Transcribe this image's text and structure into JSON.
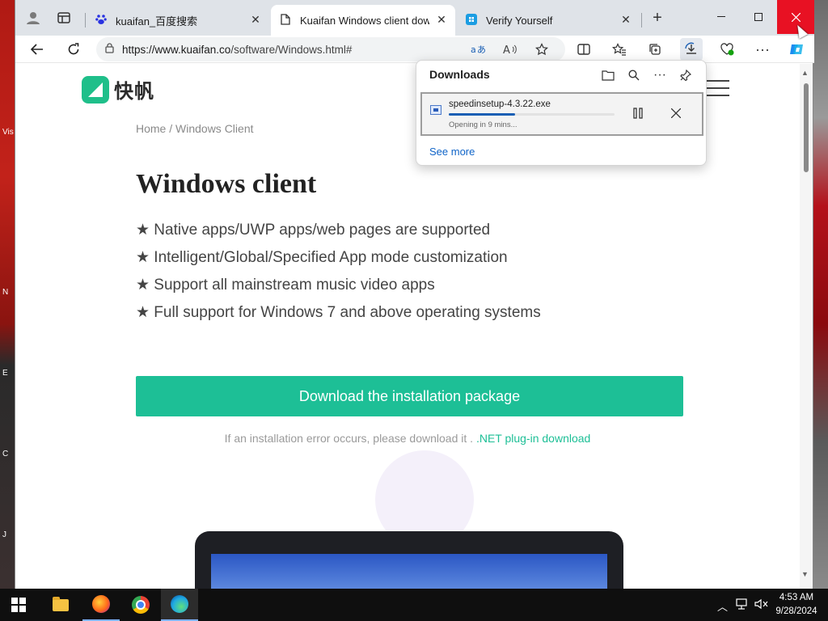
{
  "desktop": {
    "left_labels": [
      "Vis",
      "N",
      "E",
      "C",
      "J"
    ]
  },
  "browser": {
    "tabs": [
      {
        "title": "kuaifan_百度搜索",
        "active": false,
        "favicon": "baidu-paw-icon"
      },
      {
        "title": "Kuaifan Windows client downlo",
        "active": true,
        "favicon": "page-icon"
      },
      {
        "title": "Verify Yourself",
        "active": false,
        "favicon": "microsoft-verify-icon"
      }
    ],
    "new_tab_symbol": "+",
    "address_bar": {
      "url_host": "https://www.kuaifan.co",
      "url_path": "/software/Windows.html#"
    }
  },
  "page": {
    "logo_text": "快帆",
    "breadcrumb": "Home / Windows Client",
    "heading": "Windows client",
    "features": [
      "★ Native apps/UWP apps/web pages are supported",
      "★ Intelligent/Global/Specified App mode customization",
      "★ Support all mainstream music video apps",
      "★ Full support for Windows 7 and above operating systems"
    ],
    "download_button": "Download the installation package",
    "note_text": "If an installation error occurs, please download it . ",
    "note_link": ".NET plug-in download"
  },
  "downloads": {
    "title": "Downloads",
    "file_name": "speedinsetup-4.3.22.exe",
    "status": "Opening in 9 mins...",
    "progress": 0.4,
    "see_more": "See more"
  },
  "taskbar": {
    "time": "4:53 AM",
    "date": "9/28/2024"
  },
  "colors": {
    "accent": "#1dbf96",
    "close": "#e81123",
    "link": "#0f64c8"
  }
}
